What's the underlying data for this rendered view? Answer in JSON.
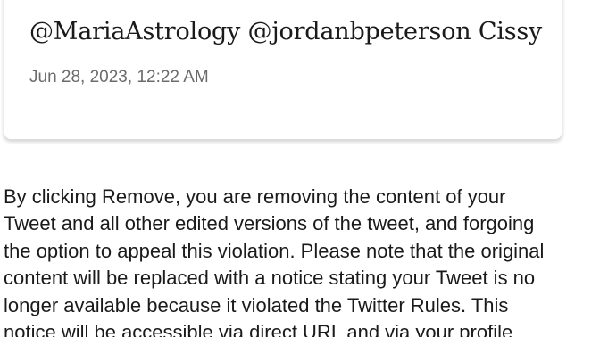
{
  "tweet": {
    "text": "@MariaAstrology @jordanbpeterson Cissy",
    "timestamp": "Jun 28, 2023, 12:22 AM"
  },
  "notice": {
    "lines": [
      "By clicking Remove, you are removing the content of your",
      "Tweet and all other edited versions of the tweet, and forgoing",
      "the option to appeal this violation. Please note that the original",
      "content will be replaced with a notice stating your Tweet is no",
      "longer available because it violated the Twitter Rules. This",
      "notice will be accessible via direct URL and via your profile"
    ]
  }
}
